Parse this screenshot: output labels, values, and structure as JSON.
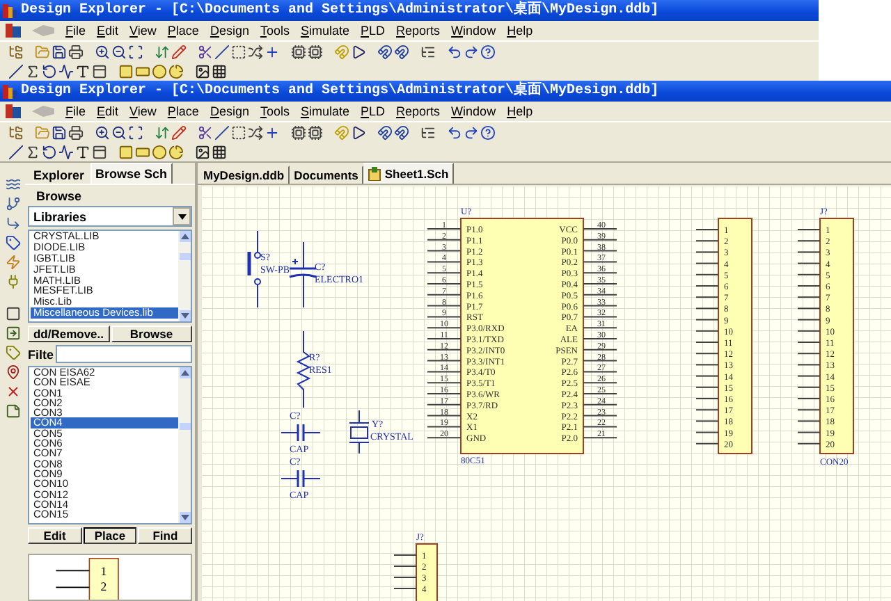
{
  "back_window": {
    "title": "Design Explorer - [C:\\Documents and Settings\\Administrator\\桌面\\MyDesign.ddb]",
    "menu": [
      "File",
      "Edit",
      "View",
      "Place",
      "Design",
      "Tools",
      "Simulate",
      "PLD",
      "Reports",
      "Window",
      "Help"
    ]
  },
  "window": {
    "title": "Design Explorer - [C:\\Documents and Settings\\Administrator\\桌面\\MyDesign.ddb]",
    "menu": [
      "File",
      "Edit",
      "View",
      "Place",
      "Design",
      "Tools",
      "Simulate",
      "PLD",
      "Reports",
      "Window",
      "Help"
    ]
  },
  "panel": {
    "tabs": [
      {
        "label": "Explorer",
        "selected": false
      },
      {
        "label": "Browse Sch",
        "selected": true
      }
    ],
    "browse_label": "Browse",
    "browse_select": "Libraries",
    "libraries": [
      {
        "name": "CRYSTAL.LIB",
        "selected": false
      },
      {
        "name": "DIODE.LIB",
        "selected": false
      },
      {
        "name": "IGBT.LIB",
        "selected": false
      },
      {
        "name": "JFET.LIB",
        "selected": false
      },
      {
        "name": "MATH.LIB",
        "selected": false
      },
      {
        "name": "MESFET.LIB",
        "selected": false
      },
      {
        "name": "Misc.Lib",
        "selected": false
      },
      {
        "name": "Miscellaneous Devices.lib",
        "selected": true
      }
    ],
    "library_buttons": [
      "dd/Remove..",
      "Browse"
    ],
    "filter_label": "Filte",
    "components": [
      {
        "name": "CON EISA62",
        "selected": false
      },
      {
        "name": "CON EISAE",
        "selected": false
      },
      {
        "name": "CON1",
        "selected": false
      },
      {
        "name": "CON2",
        "selected": false
      },
      {
        "name": "CON3",
        "selected": false
      },
      {
        "name": "CON4",
        "selected": true
      },
      {
        "name": "CON5",
        "selected": false
      },
      {
        "name": "CON6",
        "selected": false
      },
      {
        "name": "CON7",
        "selected": false
      },
      {
        "name": "CON8",
        "selected": false
      },
      {
        "name": "CON9",
        "selected": false
      },
      {
        "name": "CON10",
        "selected": false
      },
      {
        "name": "CON12",
        "selected": false
      },
      {
        "name": "CON14",
        "selected": false
      },
      {
        "name": "CON15",
        "selected": false
      }
    ],
    "component_buttons": [
      {
        "label": "Edit",
        "focused": false
      },
      {
        "label": "Place",
        "focused": true
      },
      {
        "label": "Find",
        "focused": false
      }
    ],
    "preview_pins": [
      "1",
      "2"
    ]
  },
  "document_tabs": [
    {
      "label": "MyDesign.ddb",
      "selected": false,
      "kind": "database"
    },
    {
      "label": "Documents",
      "selected": false,
      "kind": "folder"
    },
    {
      "label": "Sheet1.Sch",
      "selected": true,
      "kind": "sheet"
    }
  ],
  "schematic": {
    "mcu": {
      "ref": "U?",
      "value": "80C51",
      "left_pins": [
        {
          "number": "1",
          "name": "P1.0"
        },
        {
          "number": "2",
          "name": "P1.1"
        },
        {
          "number": "3",
          "name": "P1.2"
        },
        {
          "number": "4",
          "name": "P1.3"
        },
        {
          "number": "5",
          "name": "P1.4"
        },
        {
          "number": "6",
          "name": "P1.5"
        },
        {
          "number": "7",
          "name": "P1.6"
        },
        {
          "number": "8",
          "name": "P1.7"
        },
        {
          "number": "9",
          "name": "RST"
        },
        {
          "number": "10",
          "name": "P3.0/RXD"
        },
        {
          "number": "11",
          "name": "P3.1/TXD"
        },
        {
          "number": "12",
          "name": "P3.2/INT0"
        },
        {
          "number": "13",
          "name": "P3.3/INT1"
        },
        {
          "number": "14",
          "name": "P3.4/T0"
        },
        {
          "number": "15",
          "name": "P3.5/T1"
        },
        {
          "number": "16",
          "name": "P3.6/WR"
        },
        {
          "number": "17",
          "name": "P3.7/RD"
        },
        {
          "number": "18",
          "name": "X2"
        },
        {
          "number": "19",
          "name": "X1"
        },
        {
          "number": "20",
          "name": "GND"
        }
      ],
      "right_pins": [
        {
          "number": "40",
          "name": "VCC"
        },
        {
          "number": "39",
          "name": "P0.0"
        },
        {
          "number": "38",
          "name": "P0.1"
        },
        {
          "number": "37",
          "name": "P0.2"
        },
        {
          "number": "36",
          "name": "P0.3"
        },
        {
          "number": "35",
          "name": "P0.4"
        },
        {
          "number": "34",
          "name": "P0.5"
        },
        {
          "number": "33",
          "name": "P0.6"
        },
        {
          "number": "32",
          "name": "P0.7"
        },
        {
          "number": "31",
          "name": "EA"
        },
        {
          "number": "30",
          "name": "ALE"
        },
        {
          "number": "29",
          "name": "PSEN"
        },
        {
          "number": "28",
          "name": "P2.7"
        },
        {
          "number": "27",
          "name": "P2.6"
        },
        {
          "number": "26",
          "name": "P2.5"
        },
        {
          "number": "25",
          "name": "P2.4"
        },
        {
          "number": "24",
          "name": "P2.3"
        },
        {
          "number": "23",
          "name": "P2.2"
        },
        {
          "number": "22",
          "name": "P2.1"
        },
        {
          "number": "21",
          "name": "P2.0"
        }
      ]
    },
    "switch": {
      "ref": "S?",
      "value": "SW-PB"
    },
    "electrolytic": {
      "ref": "C?",
      "value": "ELECTRO1"
    },
    "resistor": {
      "ref": "R?",
      "value": "RES1"
    },
    "capacitors": [
      {
        "ref": "C?",
        "value": "CAP"
      },
      {
        "ref": "C?",
        "value": "CAP"
      }
    ],
    "crystal": {
      "ref": "Y?",
      "value": "CRYSTAL"
    },
    "connectors": [
      {
        "pins": [
          "1",
          "2",
          "3",
          "4",
          "5",
          "6",
          "7",
          "8",
          "9",
          "10",
          "11",
          "12",
          "13",
          "14",
          "15",
          "16",
          "17",
          "18",
          "19",
          "20"
        ]
      },
      {
        "ref": "J?",
        "value": "CON20",
        "pins": [
          "1",
          "2",
          "3",
          "4",
          "5",
          "6",
          "7",
          "8",
          "9",
          "10",
          "11",
          "12",
          "13",
          "14",
          "15",
          "16",
          "17",
          "18",
          "19",
          "20"
        ]
      },
      {
        "ref": "J?",
        "pins": [
          "1",
          "2",
          "3",
          "4"
        ]
      }
    ]
  }
}
